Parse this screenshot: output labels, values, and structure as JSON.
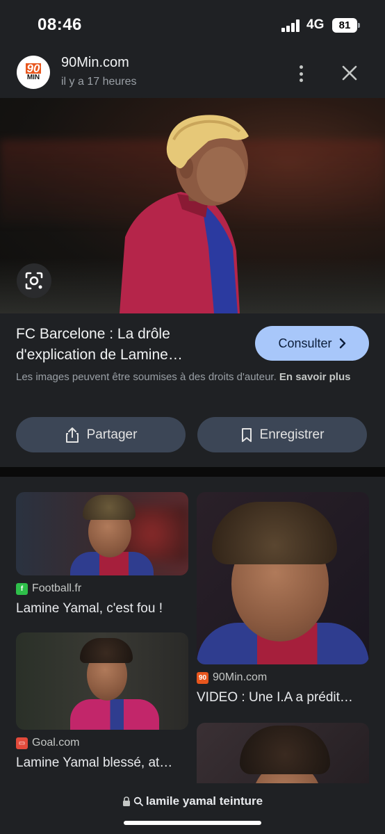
{
  "status": {
    "time": "08:46",
    "network": "4G",
    "battery": "81"
  },
  "source": {
    "logo_top": "90",
    "logo_bottom": "MIN",
    "name": "90Min.com",
    "time": "il y a 17 heures",
    "more_icon": "more-vert-icon",
    "close_icon": "close-icon"
  },
  "hero": {
    "lens_icon": "google-lens-icon"
  },
  "result": {
    "title_line1": "FC Barcelone : La drôle",
    "title_line2": "d'explication de Lamine…",
    "consult_label": "Consulter",
    "copyright_text": "Les images peuvent être soumises à des droits d'auteur.",
    "copyright_link": "En savoir plus",
    "share_label": "Partager",
    "save_label": "Enregistrer"
  },
  "related": [
    {
      "source": "Football.fr",
      "title": "Lamine Yamal, c'est fou !",
      "favicon_color": "#2fbf4a"
    },
    {
      "source": "90Min.com",
      "title": "VIDEO : Une I.A a prédit…",
      "favicon_color": "#e8561d"
    },
    {
      "source": "Goal.com",
      "title": "Lamine Yamal blessé, at…",
      "favicon_color": "#e24a3b"
    }
  ],
  "url_bar": {
    "text": "lamile yamal teinture"
  },
  "colors": {
    "background": "#1f2124",
    "accent_button": "#a8c7fa",
    "action_button": "#3c4656"
  }
}
